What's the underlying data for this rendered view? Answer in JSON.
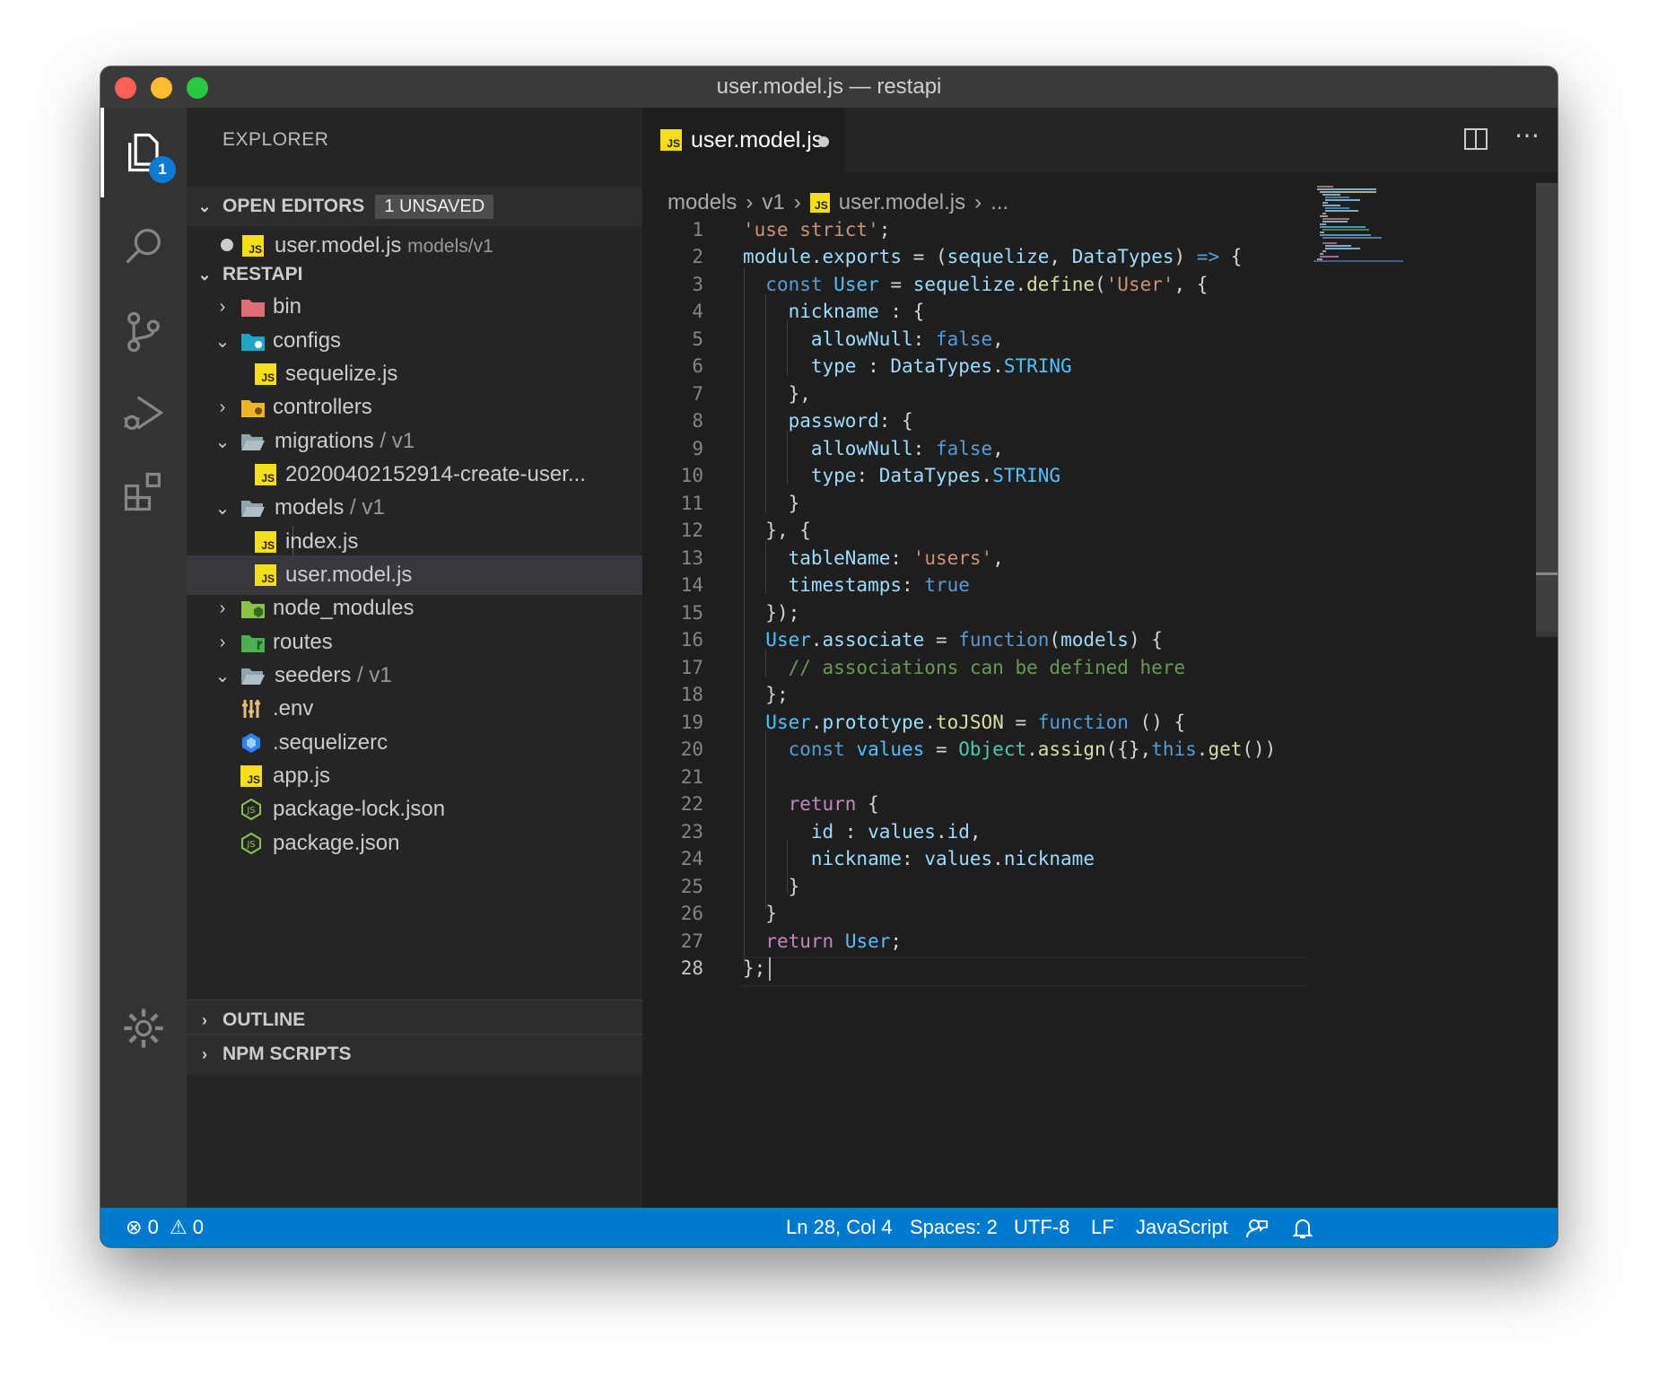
{
  "window": {
    "title": "user.model.js — restapi"
  },
  "activity_bar": {
    "explorer_badge": "1"
  },
  "sidebar": {
    "title": "EXPLORER",
    "open_editors": {
      "label": "OPEN EDITORS",
      "badge": "1 UNSAVED",
      "items": [
        {
          "name": "user.model.js",
          "path": "models/v1"
        }
      ]
    },
    "project": {
      "label": "RESTAPI"
    },
    "tree": [
      {
        "label": "bin"
      },
      {
        "label": "configs"
      },
      {
        "label": "sequelize.js"
      },
      {
        "label": "controllers"
      },
      {
        "label": "migrations",
        "suffix": " / v1"
      },
      {
        "label": "20200402152914-create-user..."
      },
      {
        "label": "models",
        "suffix": " / v1"
      },
      {
        "label": "index.js"
      },
      {
        "label": "user.model.js"
      },
      {
        "label": "node_modules"
      },
      {
        "label": "routes"
      },
      {
        "label": "seeders",
        "suffix": " / v1"
      },
      {
        "label": ".env"
      },
      {
        "label": ".sequelizerc"
      },
      {
        "label": "app.js"
      },
      {
        "label": "package-lock.json"
      },
      {
        "label": "package.json"
      }
    ],
    "outline_label": "OUTLINE",
    "npm_scripts_label": "NPM SCRIPTS"
  },
  "editor": {
    "tab": {
      "name": "user.model.js"
    },
    "breadcrumb": {
      "folder": "models",
      "subfolder": "v1",
      "file": "user.model.js",
      "more": "..."
    },
    "line_numbers": [
      "1",
      "2",
      "3",
      "4",
      "5",
      "6",
      "7",
      "8",
      "9",
      "10",
      "11",
      "12",
      "13",
      "14",
      "15",
      "16",
      "17",
      "18",
      "19",
      "20",
      "21",
      "22",
      "23",
      "24",
      "25",
      "26",
      "27",
      "28"
    ],
    "code": {
      "l1_str": "'use strict'",
      "l1_semi": ";",
      "l2_module": "module",
      "l2_exports": "exports",
      "l2_eq": " = (",
      "l2_seq": "sequelize",
      "l2_comma": ", ",
      "l2_dt": "DataTypes",
      "l2_close": ") ",
      "l2_arrow": "=>",
      "l2_brace": " {",
      "l3_const": "const",
      "l3_user": "User",
      "l3_eq": " = ",
      "l3_seq": "sequelize",
      "l3_dot": ".",
      "l3_define": "define",
      "l3_paren": "(",
      "l3_str": "'User'",
      "l3_rest": ", {",
      "l4_key": "nickname",
      "l4_rest": " : {",
      "l5_key": "allowNull",
      "l5_colon": ": ",
      "l5_val": "false",
      "l5_comma": ",",
      "l6_key": "type",
      "l6_colon": " : ",
      "l6_dt": "DataTypes",
      "l6_dot": ".",
      "l6_str": "STRING",
      "l7": "},",
      "l8_key": "password",
      "l8_rest": ": {",
      "l9_key": "allowNull",
      "l9_colon": ": ",
      "l9_val": "false",
      "l9_comma": ",",
      "l10_key": "type",
      "l10_colon": ": ",
      "l10_dt": "DataTypes",
      "l10_dot": ".",
      "l10_str": "STRING",
      "l11": "}",
      "l12": "}, {",
      "l13_key": "tableName",
      "l13_colon": ": ",
      "l13_str": "'users'",
      "l13_comma": ",",
      "l14_key": "timestamps",
      "l14_colon": ": ",
      "l14_val": "true",
      "l15": "});",
      "l16_user": "User",
      "l16_dot": ".",
      "l16_assoc": "associate",
      "l16_eq": " = ",
      "l16_fn": "function",
      "l16_paren": "(",
      "l16_models": "models",
      "l16_rest": ") {",
      "l17_comment": "// associations can be defined here",
      "l18": "};",
      "l19_user": "User",
      "l19_dot": ".",
      "l19_proto": "prototype",
      "l19_dot2": ".",
      "l19_tojson": "toJSON",
      "l19_eq": " = ",
      "l19_fn": "function",
      "l19_rest": " () {",
      "l20_const": "const",
      "l20_values": "values",
      "l20_eq": " = ",
      "l20_obj": "Object",
      "l20_dot": ".",
      "l20_assign": "assign",
      "l20_args": "({},",
      "l20_this": "this",
      "l20_dot2": ".",
      "l20_get": "get",
      "l20_close": "())",
      "l22_return": "return",
      "l22_brace": " {",
      "l23_id": "id",
      "l23_colon": " : ",
      "l23_values": "values",
      "l23_dot": ".",
      "l23_idprop": "id",
      "l23_comma": ",",
      "l24_key": "nickname",
      "l24_colon": ": ",
      "l24_values": "values",
      "l24_dot": ".",
      "l24_prop": "nickname",
      "l25": "}",
      "l26": "}",
      "l27_return": "return",
      "l27_user": "User",
      "l27_semi": ";",
      "l28": "};"
    }
  },
  "status_bar": {
    "errors": "0",
    "warnings": "0",
    "position": "Ln 28, Col 4",
    "spaces": "Spaces: 2",
    "encoding": "UTF-8",
    "eol": "LF",
    "language": "JavaScript"
  },
  "colors": {
    "status_bar": "#007acc",
    "activity_bar": "#333333",
    "sidebar": "#252526",
    "editor": "#1e1e1e",
    "js_icon": "#f5de19"
  }
}
